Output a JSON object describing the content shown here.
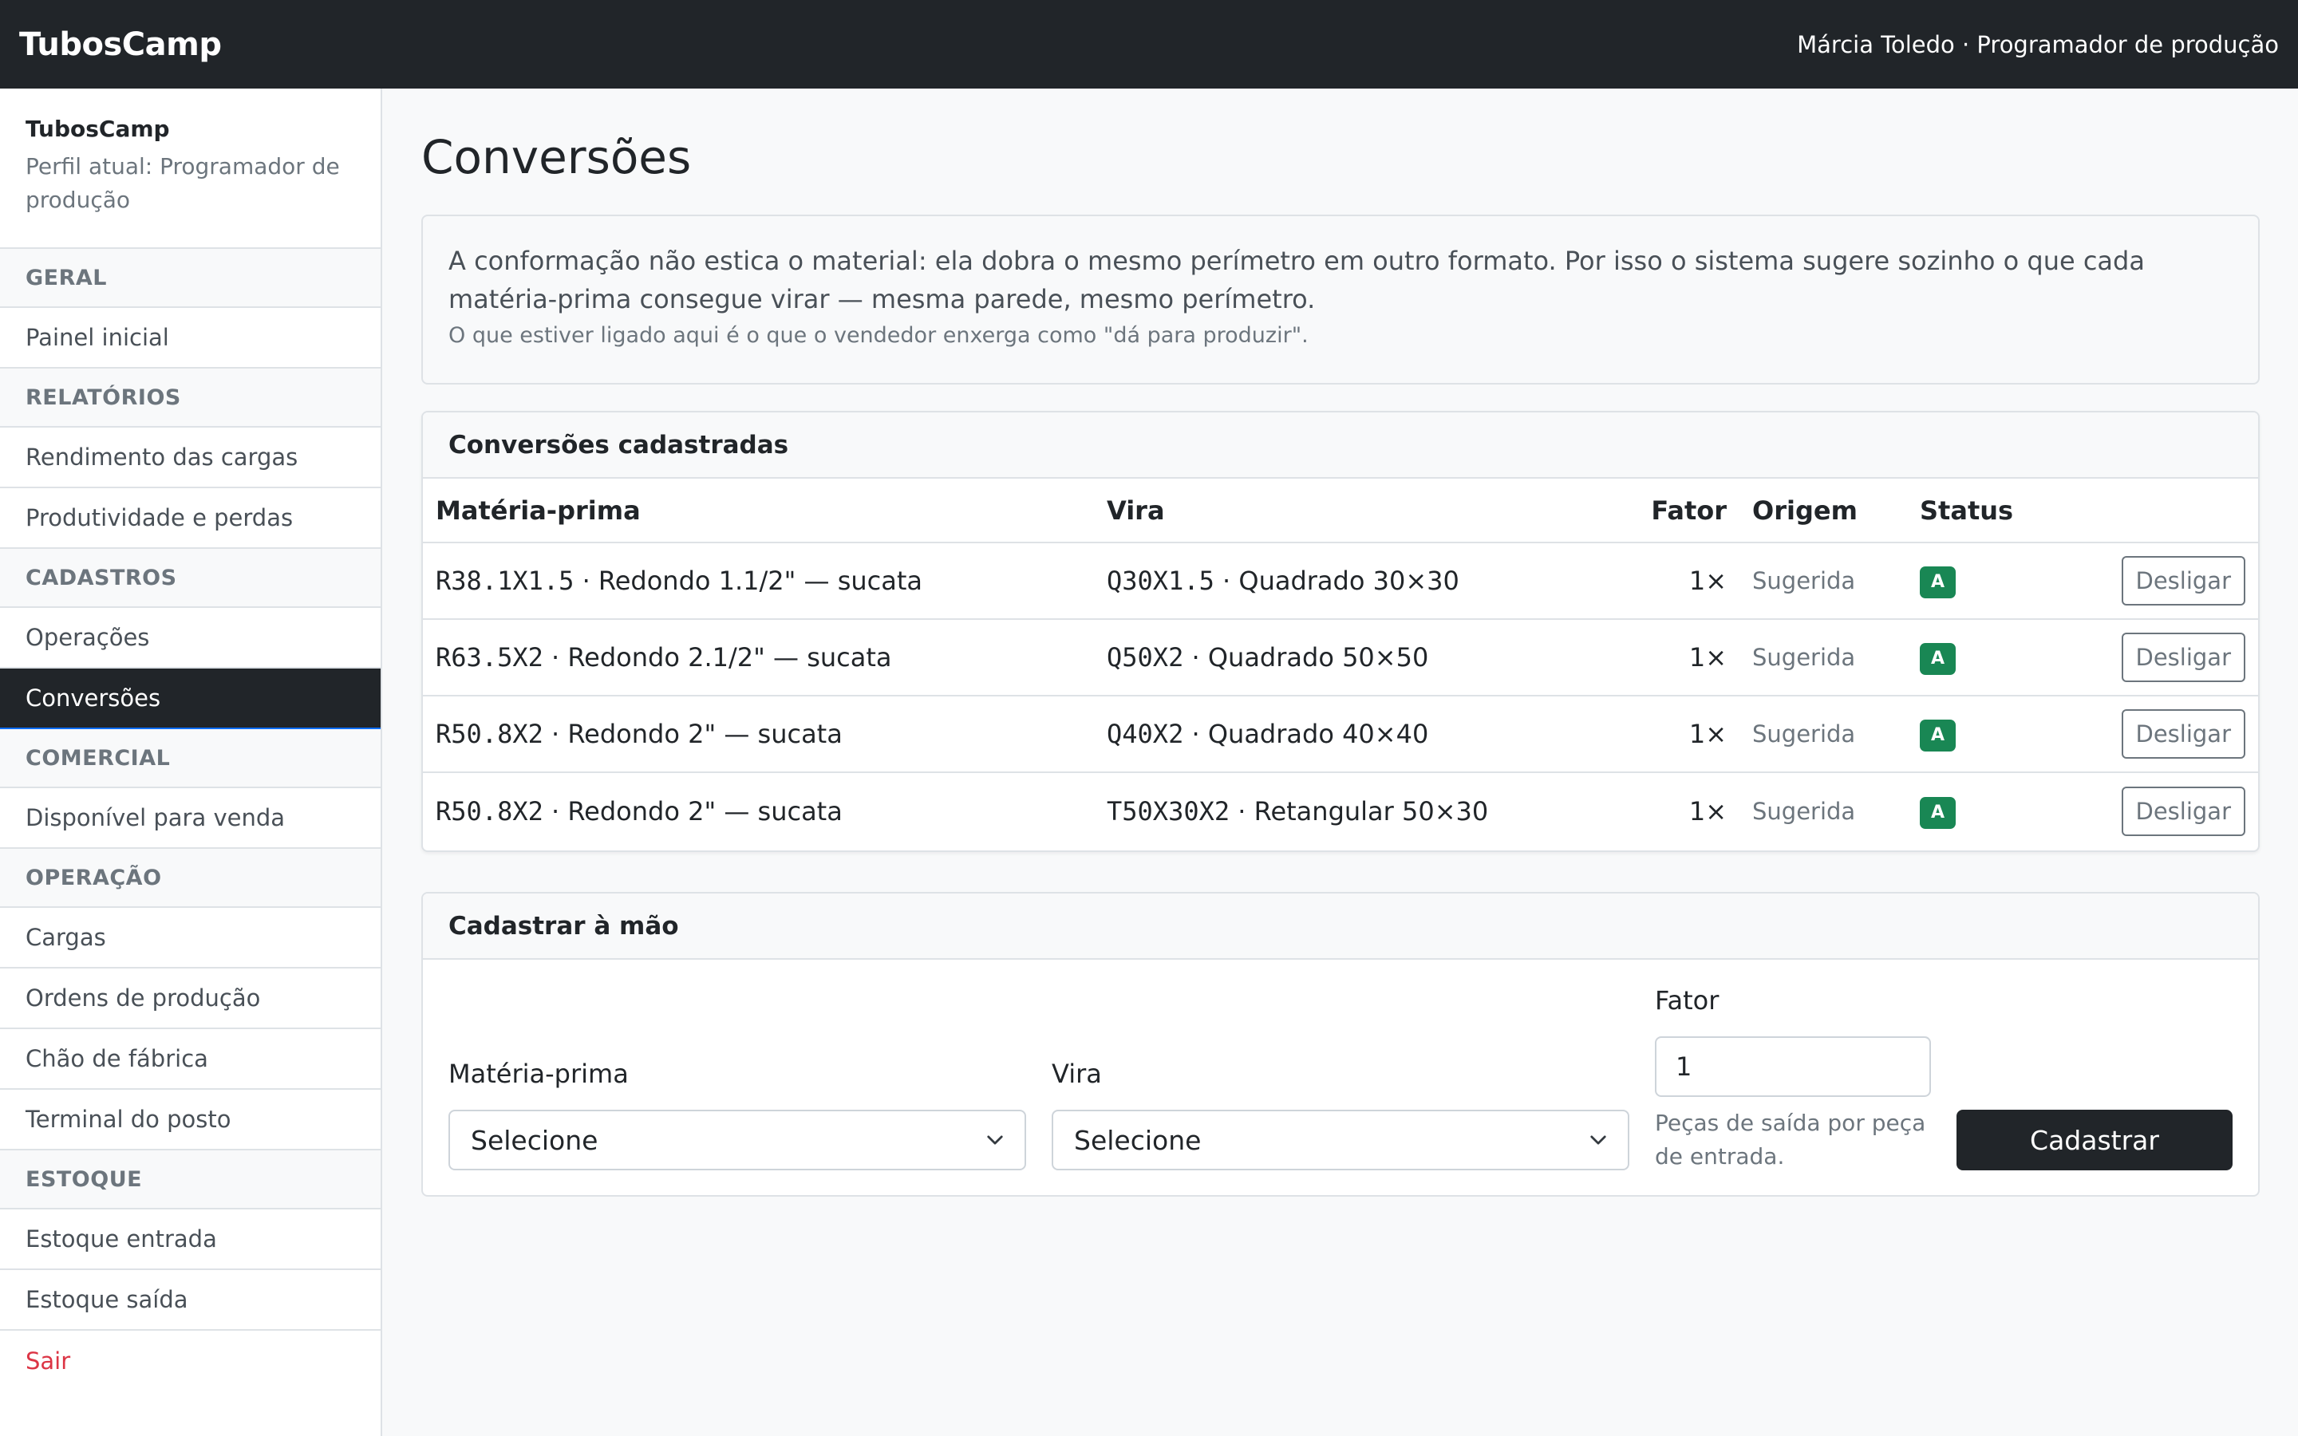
{
  "app": {
    "brand": "TubosCamp",
    "user": "Márcia Toledo · Programador de produção"
  },
  "sidebar": {
    "brand": "TubosCamp",
    "profile": "Perfil atual: Programador de produção",
    "sections": {
      "geral": "GERAL",
      "relatorios": "RELATÓRIOS",
      "cadastros": "CADASTROS",
      "comercial": "COMERCIAL",
      "operacao": "OPERAÇÃO",
      "estoque": "ESTOQUE"
    },
    "items": {
      "painel": "Painel inicial",
      "rendimento": "Rendimento das cargas",
      "produtividade": "Produtividade e perdas",
      "operacoes": "Operações",
      "conversoes": "Conversões",
      "disponivel": "Disponível para venda",
      "cargas": "Cargas",
      "ordens": "Ordens de produção",
      "chao": "Chão de fábrica",
      "terminal": "Terminal do posto",
      "estoque_entrada": "Estoque entrada",
      "estoque_saida": "Estoque saída",
      "sair": "Sair"
    }
  },
  "page": {
    "title": "Conversões",
    "info_main": "A conformação não estica o material: ela dobra o mesmo perímetro em outro formato. Por isso o sistema sugere sozinho o que cada matéria-prima consegue virar — mesma parede, mesmo perímetro.",
    "info_note": "O que estiver ligado aqui é o que o vendedor enxerga como \"dá para produzir\"."
  },
  "conversions": {
    "title": "Conversões cadastradas",
    "headers": {
      "materia": "Matéria-prima",
      "vira": "Vira",
      "fator": "Fator",
      "origem": "Origem",
      "status": "Status"
    },
    "rows": [
      {
        "mp_code": "R38.1X1.5",
        "mp_desc": " · Redondo 1.1/2\" — sucata",
        "vira_code": "Q30X1.5",
        "vira_desc": " · Quadrado 30×30",
        "fator": "1×",
        "origem": "Sugerida",
        "status": "A",
        "action": "Desligar"
      },
      {
        "mp_code": "R63.5X2",
        "mp_desc": " · Redondo 2.1/2\" — sucata",
        "vira_code": "Q50X2",
        "vira_desc": " · Quadrado 50×50",
        "fator": "1×",
        "origem": "Sugerida",
        "status": "A",
        "action": "Desligar"
      },
      {
        "mp_code": "R50.8X2",
        "mp_desc": " · Redondo 2\" — sucata",
        "vira_code": "Q40X2",
        "vira_desc": " · Quadrado 40×40",
        "fator": "1×",
        "origem": "Sugerida",
        "status": "A",
        "action": "Desligar"
      },
      {
        "mp_code": "R50.8X2",
        "mp_desc": " · Redondo 2\" — sucata",
        "vira_code": "T50X30X2",
        "vira_desc": " · Retangular 50×30",
        "fator": "1×",
        "origem": "Sugerida",
        "status": "A",
        "action": "Desligar"
      }
    ]
  },
  "form": {
    "title": "Cadastrar à mão",
    "materia_label": "Matéria-prima",
    "materia_value": "Selecione",
    "vira_label": "Vira",
    "vira_value": "Selecione",
    "fator_label": "Fator",
    "fator_value": "1",
    "fator_help": "Peças de saída por peça de entrada.",
    "submit": "Cadastrar"
  },
  "colors": {
    "navbar": "#212529",
    "active_nav": "#212529",
    "status_badge": "#198754",
    "logout": "#dc3545"
  }
}
